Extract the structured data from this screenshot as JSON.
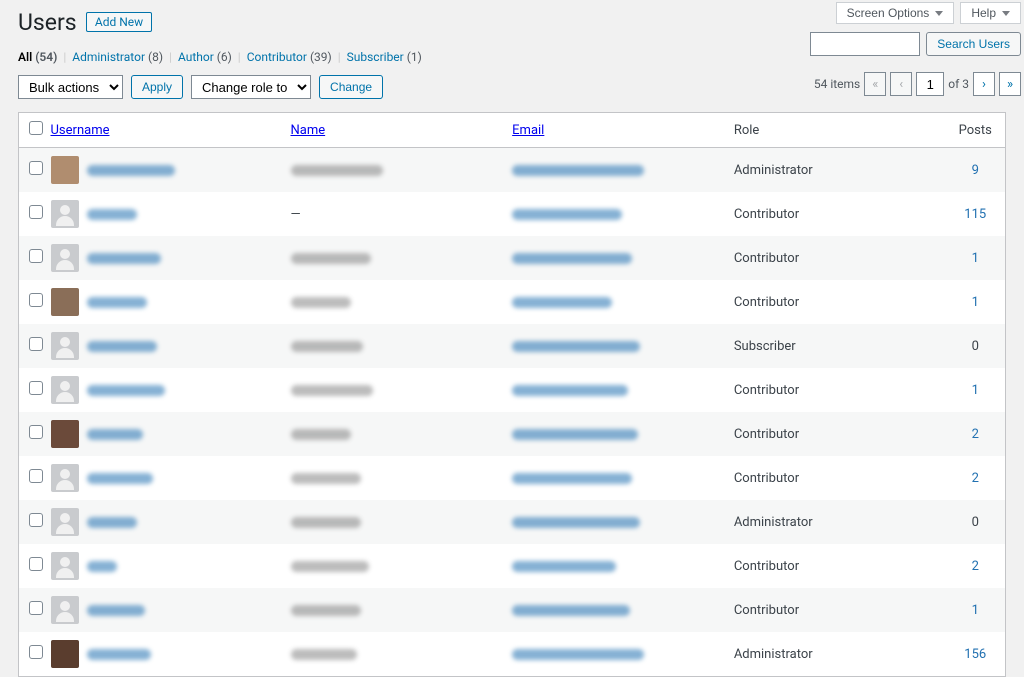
{
  "top_buttons": {
    "screen_options": "Screen Options",
    "help": "Help"
  },
  "header": {
    "title": "Users",
    "add_new": "Add New"
  },
  "search": {
    "placeholder": "",
    "button": "Search Users"
  },
  "filters": {
    "all_label": "All",
    "all_count": "(54)",
    "administrator_label": "Administrator",
    "administrator_count": "(8)",
    "author_label": "Author",
    "author_count": "(6)",
    "contributor_label": "Contributor",
    "contributor_count": "(39)",
    "subscriber_label": "Subscriber",
    "subscriber_count": "(1)"
  },
  "actions": {
    "bulk": "Bulk actions",
    "apply": "Apply",
    "change_role": "Change role to...",
    "change": "Change"
  },
  "pagination": {
    "count_label": "54 items",
    "current": "1",
    "of_label": "of 3",
    "first": "«",
    "prev": "‹",
    "next": "›",
    "last": "»"
  },
  "columns": {
    "username": "Username",
    "name": "Name",
    "email": "Email",
    "role": "Role",
    "posts": "Posts"
  },
  "rows": [
    {
      "avatar": "c1",
      "uw": 88,
      "nw": 92,
      "ew": 132,
      "role": "Administrator",
      "posts": "9",
      "posts_link": true,
      "name_dash": false
    },
    {
      "avatar": "default",
      "uw": 50,
      "nw": 0,
      "ew": 110,
      "role": "Contributor",
      "posts": "115",
      "posts_link": true,
      "name_dash": true
    },
    {
      "avatar": "default",
      "uw": 74,
      "nw": 80,
      "ew": 120,
      "role": "Contributor",
      "posts": "1",
      "posts_link": true,
      "name_dash": false
    },
    {
      "avatar": "c2",
      "uw": 60,
      "nw": 60,
      "ew": 100,
      "role": "Contributor",
      "posts": "1",
      "posts_link": true,
      "name_dash": false
    },
    {
      "avatar": "default",
      "uw": 70,
      "nw": 72,
      "ew": 128,
      "role": "Subscriber",
      "posts": "0",
      "posts_link": false,
      "name_dash": false
    },
    {
      "avatar": "default",
      "uw": 78,
      "nw": 82,
      "ew": 116,
      "role": "Contributor",
      "posts": "1",
      "posts_link": true,
      "name_dash": false
    },
    {
      "avatar": "c3",
      "uw": 56,
      "nw": 60,
      "ew": 126,
      "role": "Contributor",
      "posts": "2",
      "posts_link": true,
      "name_dash": false
    },
    {
      "avatar": "default",
      "uw": 66,
      "nw": 70,
      "ew": 120,
      "role": "Contributor",
      "posts": "2",
      "posts_link": true,
      "name_dash": false
    },
    {
      "avatar": "default",
      "uw": 50,
      "nw": 70,
      "ew": 128,
      "role": "Administrator",
      "posts": "0",
      "posts_link": false,
      "name_dash": false
    },
    {
      "avatar": "default",
      "uw": 30,
      "nw": 78,
      "ew": 104,
      "role": "Contributor",
      "posts": "2",
      "posts_link": true,
      "name_dash": false
    },
    {
      "avatar": "default",
      "uw": 58,
      "nw": 70,
      "ew": 118,
      "role": "Contributor",
      "posts": "1",
      "posts_link": true,
      "name_dash": false
    },
    {
      "avatar": "c4",
      "uw": 64,
      "nw": 66,
      "ew": 132,
      "role": "Administrator",
      "posts": "156",
      "posts_link": true,
      "name_dash": false
    }
  ]
}
